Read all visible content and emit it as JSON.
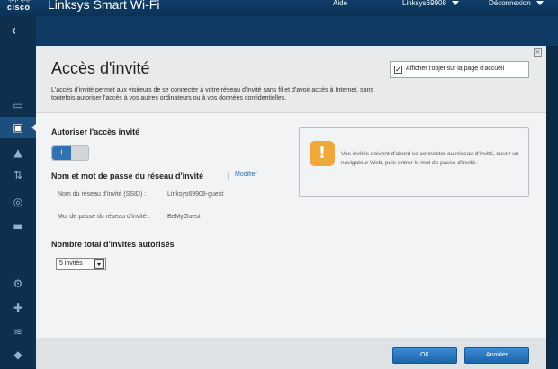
{
  "header": {
    "brand": "cisco",
    "app_title": "Linksys Smart Wi-Fi",
    "help": "Aide",
    "account": "Linksys69908",
    "logout": "Déconnexion"
  },
  "sidebar": {
    "back_icon": "back-arrow-icon",
    "items": [
      {
        "icon": "device-list-icon"
      },
      {
        "icon": "guest-access-icon"
      },
      {
        "icon": "parental-controls-icon"
      },
      {
        "icon": "media-prioritization-icon"
      },
      {
        "icon": "speed-test-icon"
      },
      {
        "icon": "external-storage-icon"
      },
      {
        "icon": "connectivity-icon"
      },
      {
        "icon": "troubleshooting-icon"
      },
      {
        "icon": "wireless-icon"
      },
      {
        "icon": "security-icon"
      }
    ]
  },
  "panel": {
    "title": "Accès d'invité",
    "description": "L'accès d'invité permet aux visiteurs de se connecter à votre réseau d'invité sans fil et d'avoir accès à Internet, sans toutefois autoriser l'accès à vos autres ordinateurs ou à vos données confidentielles.",
    "show_on_home_label": "Afficher l'objet sur la page d'accueil",
    "show_on_home_checked": true,
    "allow_title": "Autoriser l'accès invité",
    "toggle_state": "I",
    "network_title": "Nom et mot de passe du réseau d'invité",
    "separator": "|",
    "modify_link": "Modifier",
    "ssid_label": "Nom du réseau d'invité (SSID) :",
    "ssid_value": "Linksys69908-guest",
    "password_label": "Mot de passe du réseau d'invité :",
    "password_value": "BeMyGuest",
    "total_title": "Nombre total d'invités autorisés",
    "guests_selected": "5 invités",
    "info_icon": "!",
    "info_text": "Vos invités doivent d'abord se connecter au réseau d'invité, ouvrir un navigateur Web, puis entrer le mot de passe d'invité.",
    "ok_label": "OK",
    "cancel_label": "Annuler"
  }
}
